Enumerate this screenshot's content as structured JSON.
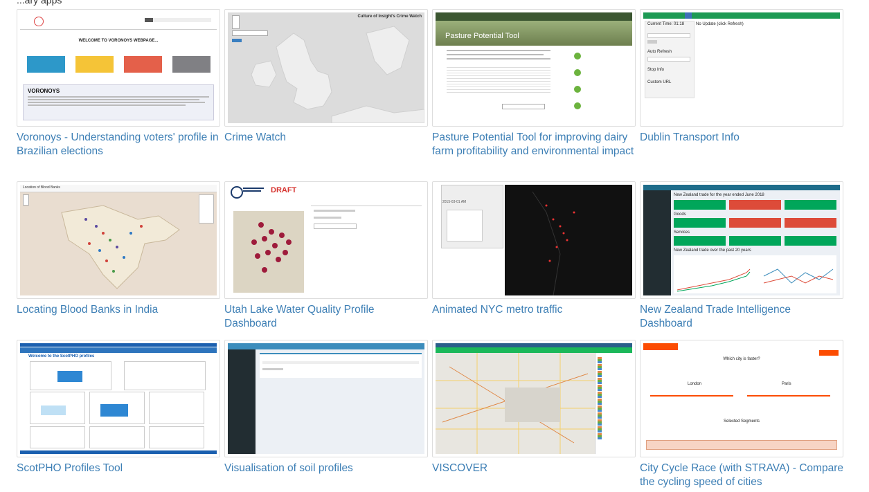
{
  "page_top_snip": "...ary apps",
  "gallery": [
    {
      "title": "Voronoys - Understanding voters' profile in Brazilian elections",
      "thumb": "voronoys",
      "thumb_text": {
        "heading": "WELCOME TO VORONOYS WEBPAGE...",
        "section": "VORONOYS"
      }
    },
    {
      "title": "Crime Watch",
      "thumb": "crimewatch",
      "thumb_text": {
        "heading": "Culture of Insight's Crime Watch"
      }
    },
    {
      "title": "Pasture Potential Tool for improving dairy farm profitability and environmental impact",
      "thumb": "pasture",
      "thumb_text": {
        "heading": "Pasture Potential Tool"
      }
    },
    {
      "title": "Dublin Transport Info",
      "thumb": "dublin",
      "thumb_text": {
        "current_time": "Current Time: 01:18",
        "no_update": "No Update (click Refresh)",
        "auto_refresh": "Auto Refresh",
        "stop_info": "Stop Info",
        "custom_url": "Custom URL"
      }
    },
    {
      "title": "Locating Blood Banks in India",
      "thumb": "bloodbanks",
      "thumb_text": {
        "heading": "Location of Blood Banks"
      }
    },
    {
      "title": "Utah Lake Water Quality Profile Dashboard",
      "thumb": "utah",
      "thumb_text": {
        "draft": "DRAFT"
      }
    },
    {
      "title": "Animated NYC metro traffic",
      "thumb": "nyc",
      "thumb_text": {
        "time": "2015-03-01 AM"
      }
    },
    {
      "title": "New Zealand Trade Intelligence Dashboard",
      "thumb": "nztrade",
      "thumb_text": {
        "heading": "New Zealand trade for the year ended June 2018",
        "goods": "Goods",
        "services": "Services",
        "chart_heading": "New Zealand trade over the past 20 years"
      }
    },
    {
      "title": "ScotPHO Profiles Tool",
      "thumb": "scotpho",
      "thumb_text": {
        "heading": "Welcome to the ScotPHO profiles"
      }
    },
    {
      "title": "Visualisation of soil profiles",
      "thumb": "soil",
      "thumb_text": {}
    },
    {
      "title": "VISCOVER",
      "thumb": "viscover",
      "thumb_text": {}
    },
    {
      "title": "City Cycle Race (with STRAVA) - Compare the cycling speed of cities",
      "thumb": "cycle",
      "thumb_text": {
        "heading": "Which city is faster?",
        "london": "London",
        "paris": "Paris",
        "selected": "Selected Segments"
      }
    }
  ]
}
